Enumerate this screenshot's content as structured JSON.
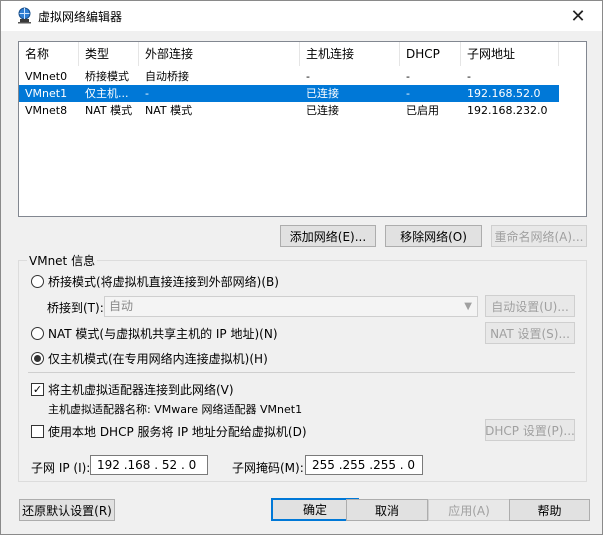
{
  "window": {
    "title": "虚拟网络编辑器"
  },
  "network_list": {
    "columns": [
      "名称",
      "类型",
      "外部连接",
      "主机连接",
      "DHCP",
      "子网地址"
    ],
    "rows": [
      {
        "name": "VMnet0",
        "type": "桥接模式",
        "external": "自动桥接",
        "host": "-",
        "dhcp": "-",
        "subnet": "-",
        "selected": false
      },
      {
        "name": "VMnet1",
        "type": "仅主机...",
        "external": "-",
        "host": "已连接",
        "dhcp": "-",
        "subnet": "192.168.52.0",
        "selected": true
      },
      {
        "name": "VMnet8",
        "type": "NAT 模式",
        "external": "NAT 模式",
        "host": "已连接",
        "dhcp": "已启用",
        "subnet": "192.168.232.0",
        "selected": false
      }
    ]
  },
  "list_buttons": {
    "add": "添加网络(E)...",
    "remove": "移除网络(O)",
    "rename": "重命名网络(A)..."
  },
  "vmnet_info": {
    "title": "VMnet 信息",
    "bridge_mode": "桥接模式(将虚拟机直接连接到外部网络)(B)",
    "bridge_to_label": "桥接到(T):",
    "bridge_to_value": "自动",
    "auto_settings": "自动设置(U)...",
    "nat_mode": "NAT 模式(与虚拟机共享主机的 IP 地址)(N)",
    "nat_settings": "NAT 设置(S)...",
    "host_only_mode": "仅主机模式(在专用网络内连接虚拟机)(H)",
    "selected_mode": "host_only",
    "connect_adapter": "将主机虚拟适配器连接到此网络(V)",
    "connect_adapter_checked": true,
    "adapter_name": "主机虚拟适配器名称: VMware 网络适配器 VMnet1",
    "use_dhcp": "使用本地 DHCP 服务将 IP 地址分配给虚拟机(D)",
    "use_dhcp_checked": false,
    "dhcp_settings": "DHCP 设置(P)...",
    "subnet_ip_label": "子网 IP (I):",
    "subnet_ip_value": "192 .168 . 52 . 0",
    "subnet_mask_label": "子网掩码(M):",
    "subnet_mask_value": "255 .255 .255 . 0"
  },
  "footer_buttons": {
    "restore": "还原默认设置(R)",
    "ok": "确定",
    "cancel": "取消",
    "apply": "应用(A)",
    "help": "帮助"
  },
  "colors": {
    "selection": "#0078d7",
    "window_bg": "#f0f0f0",
    "disabled_text": "#a0a0a0"
  }
}
